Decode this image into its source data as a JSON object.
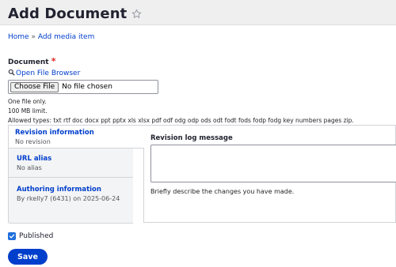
{
  "header": {
    "title": "Add Document",
    "star_icon": "star-outline-icon"
  },
  "breadcrumb": {
    "home": "Home",
    "separator": "»",
    "current": "Add media item"
  },
  "document_field": {
    "label": "Document",
    "required_marker": "*",
    "open_browser_icon": "magnifier-icon",
    "open_browser_label": "Open File Browser",
    "choose_button": "Choose File",
    "no_file_text": "No file chosen",
    "desc_one_file": "One file only.",
    "desc_limit": "100 MB limit.",
    "desc_allowed": "Allowed types: txt rtf doc docx ppt pptx xls xlsx pdf odf odg odp ods odt fodt fods fodp fodg key numbers pages zip."
  },
  "vertical_tabs": {
    "revision": {
      "title": "Revision information",
      "summary": "No revision"
    },
    "url_alias": {
      "title": "URL alias",
      "summary": "No alias"
    },
    "authoring": {
      "title": "Authoring information",
      "summary": "By rkelly7 (6431) on 2025-06-24"
    }
  },
  "revision_pane": {
    "label": "Revision log message",
    "textarea_value": "",
    "description": "Briefly describe the changes you have made."
  },
  "published": {
    "label": "Published",
    "checked": true
  },
  "actions": {
    "save_label": "Save"
  },
  "colors": {
    "link": "#003ecc",
    "primary_button": "#003ecc",
    "required": "#dc2323",
    "checkbox": "#1f6fdc"
  }
}
